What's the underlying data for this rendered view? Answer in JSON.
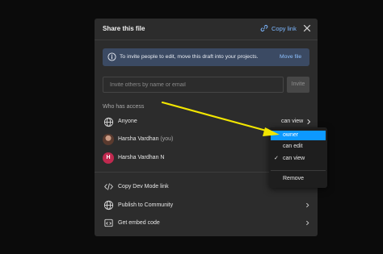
{
  "header": {
    "title": "Share this file",
    "copy_link": "Copy link"
  },
  "banner": {
    "text": "To invite people to edit, move this draft into your projects.",
    "action": "Move file"
  },
  "invite": {
    "placeholder": "Invite others by name or email",
    "button": "Invite"
  },
  "access": {
    "label": "Who has access",
    "rows": [
      {
        "name": "Anyone",
        "role": "can view"
      },
      {
        "name": "Harsha Vardhan",
        "suffix": "(you)"
      },
      {
        "name": "Harsha Vardhan N",
        "initial": "H"
      }
    ]
  },
  "footer": {
    "items": [
      {
        "label": "Copy Dev Mode link"
      },
      {
        "label": "Publish to Community"
      },
      {
        "label": "Get embed code"
      }
    ]
  },
  "dropdown": {
    "items": [
      "owner",
      "can edit",
      "can view"
    ],
    "selected_check": "✓",
    "remove": "Remove"
  },
  "colors": {
    "accent": "#0d99ff",
    "annotation_arrow": "#f2e600",
    "link": "#7cb7ff",
    "avatar_h": "#c1294f"
  }
}
